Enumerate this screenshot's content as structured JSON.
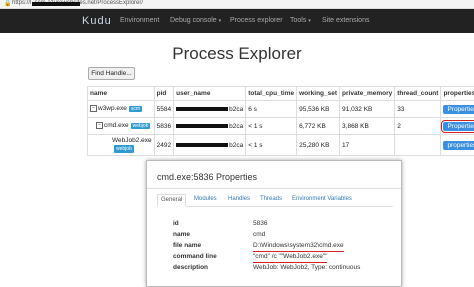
{
  "browser": {
    "url": "https://l                    .scm.azurewebsites.net/ProcessExplorer/"
  },
  "nav": {
    "brand": "Kudu",
    "items": [
      "Environment",
      "Debug console",
      "Process explorer",
      "Tools",
      "Site extensions"
    ],
    "caret": "▾"
  },
  "page": {
    "title": "Process Explorer",
    "find_handle_label": "Find Handle..."
  },
  "table": {
    "columns": [
      "name",
      "pid",
      "user_name",
      "total_cpu_time",
      "working_set",
      "private_memory",
      "thread_count",
      "properties"
    ],
    "rows": [
      {
        "name": "w3wp.exe",
        "tag": "scm",
        "pid": "5584",
        "user_suffix": "b2ca",
        "cpu": "6 s",
        "ws": "95,536 KB",
        "pm": "91,032 KB",
        "threads": "33",
        "props": "Properties..."
      },
      {
        "name": "cmd.exe",
        "tag": "webjob",
        "pid": "5836",
        "user_suffix": "b2ca",
        "cpu": "< 1 s",
        "ws": "6,772 KB",
        "pm": "3,868 KB",
        "threads": "2",
        "props": "Properties..."
      },
      {
        "name": "WebJob2.exe",
        "tag": "webjob",
        "pid": "2492",
        "user_suffix": "b2ca",
        "cpu": "< 1 s",
        "ws": "25,280 KB",
        "pm": "17",
        "threads": "",
        "props": "properties"
      }
    ]
  },
  "modal": {
    "title": "cmd.exe:5836 Properties",
    "tabs": [
      "General",
      "Modules",
      "Handles",
      "Threads",
      "Environment Variables"
    ],
    "fields": [
      {
        "key": "id",
        "value": "5836"
      },
      {
        "key": "name",
        "value": "cmd"
      },
      {
        "key": "file name",
        "value": "D:\\Windows\\system32\\cmd.exe"
      },
      {
        "key": "command line",
        "value": "\"cmd\" /c \"\"WebJob2.exe\"\""
      },
      {
        "key": "description",
        "value": "WebJob: WebJob2, Type: continuous"
      }
    ]
  }
}
